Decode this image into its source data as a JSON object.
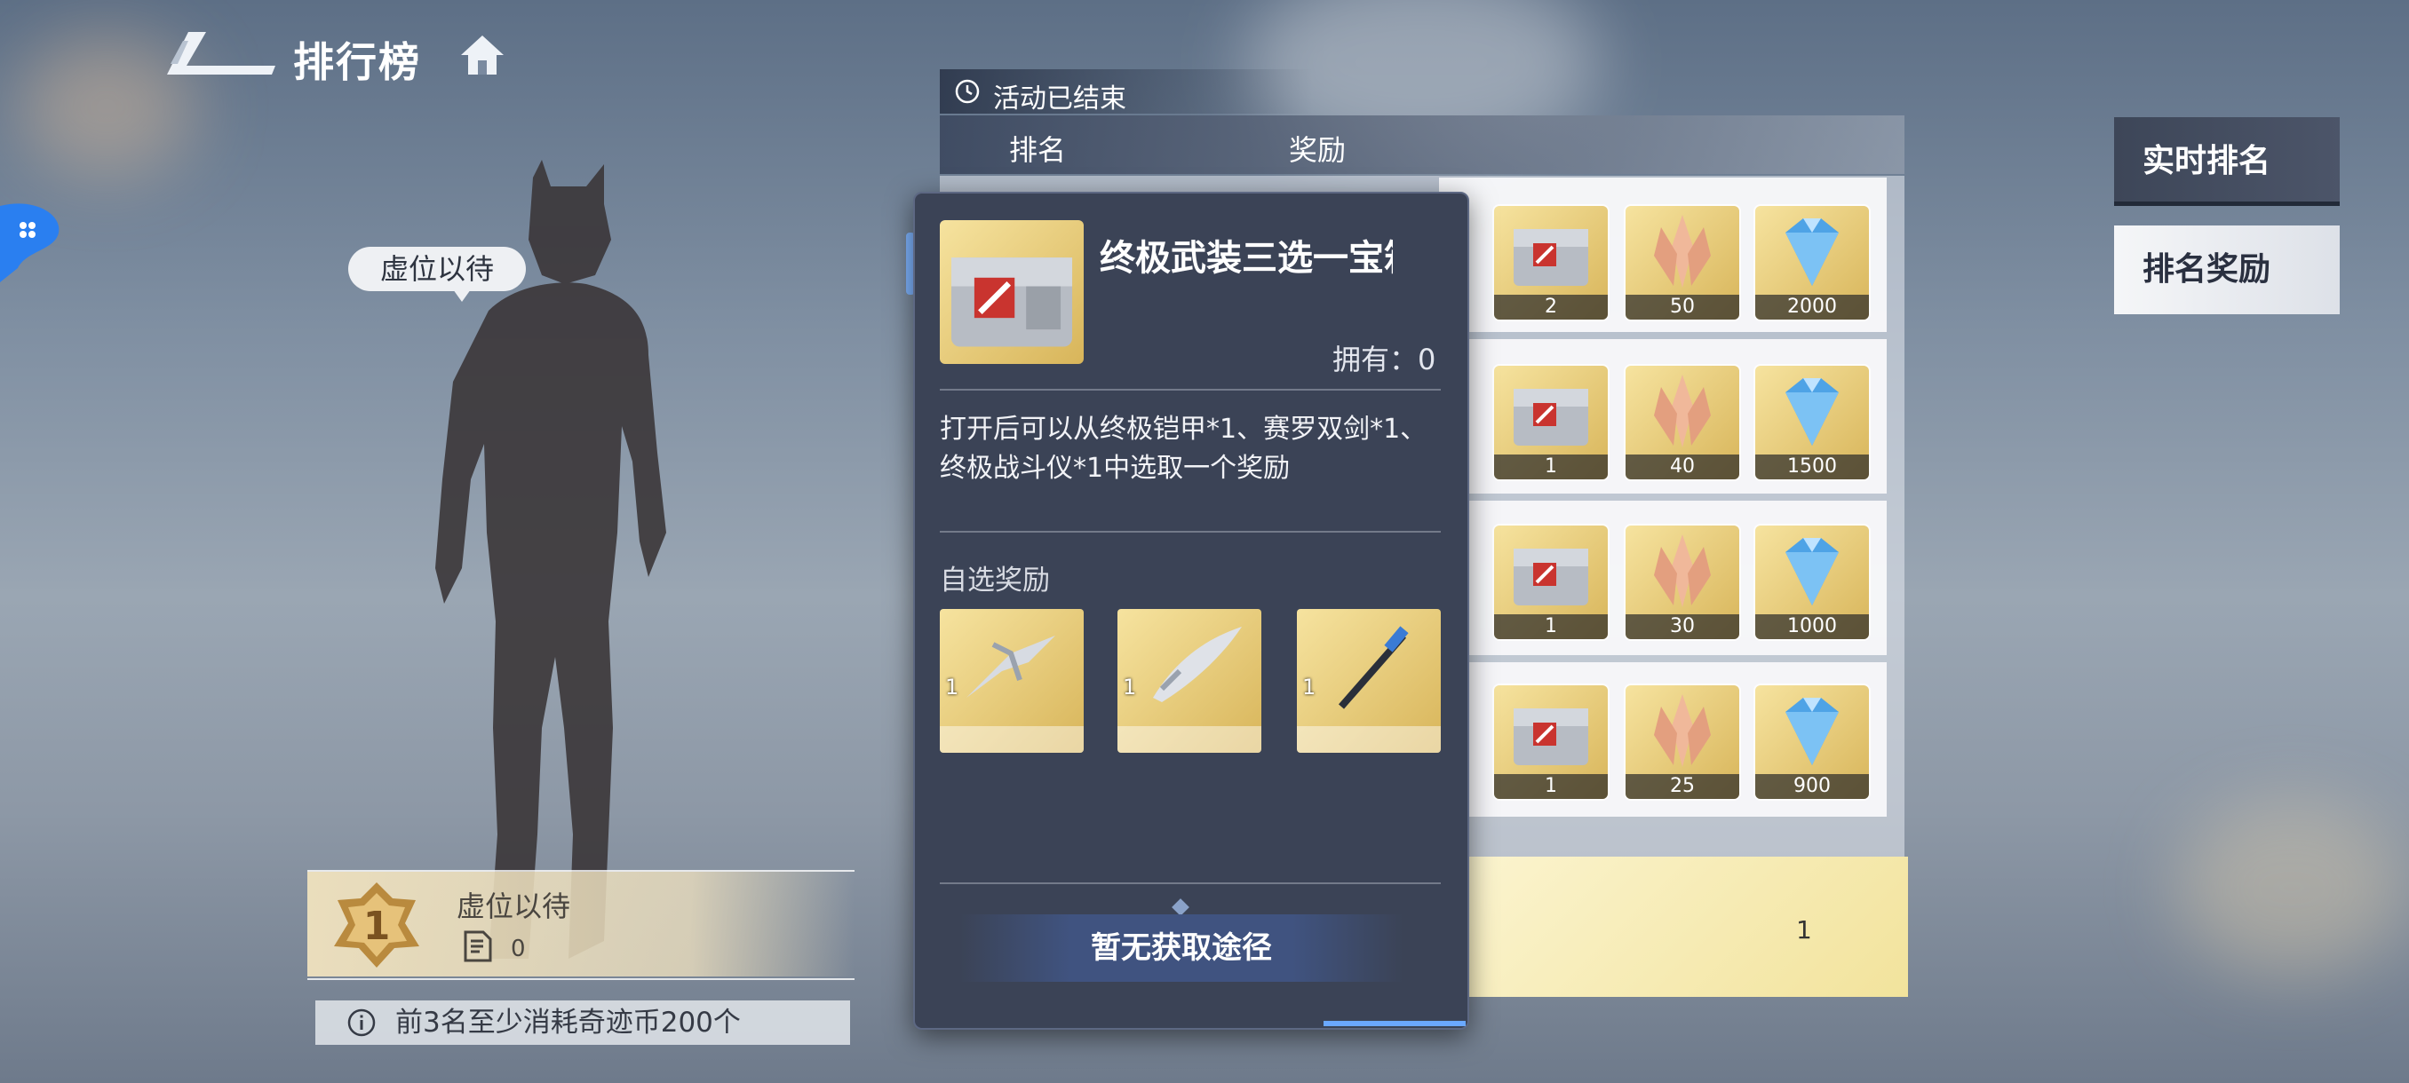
{
  "header": {
    "title": "排行榜"
  },
  "hero": {
    "speech": "虚位以待"
  },
  "my_rank": {
    "rank": "1",
    "name": "虚位以待",
    "coins": "0"
  },
  "notice": {
    "text": "前3名至少消耗奇迹币200个"
  },
  "table": {
    "status": "活动已结束",
    "col_rank": "排名",
    "col_reward": "奖励",
    "rows": [
      {
        "chest": "2",
        "crystal": "50",
        "diamond": "2000"
      },
      {
        "chest": "1",
        "crystal": "40",
        "diamond": "1500"
      },
      {
        "chest": "1",
        "crystal": "30",
        "diamond": "1000"
      },
      {
        "chest": "1",
        "crystal": "25",
        "diamond": "900"
      }
    ],
    "my_value": "1"
  },
  "tabs": {
    "live": "实时排名",
    "reward": "排名奖励"
  },
  "tooltip": {
    "title": "终极武装三选一宝箱",
    "owned": "拥有：0",
    "desc": "打开后可以从终极铠甲*1、赛罗双剑*1、终极战斗仪*1中选取一个奖励",
    "sub": "自选奖励",
    "options": [
      {
        "count": "1",
        "icon": "armor-icon"
      },
      {
        "count": "1",
        "icon": "twin-blade-icon"
      },
      {
        "count": "1",
        "icon": "battle-device-icon"
      }
    ],
    "button": "暂无获取途径"
  },
  "colors": {
    "panel": "#3b4356",
    "accent": "#6aa8ff",
    "gold": "#d8b55a"
  }
}
